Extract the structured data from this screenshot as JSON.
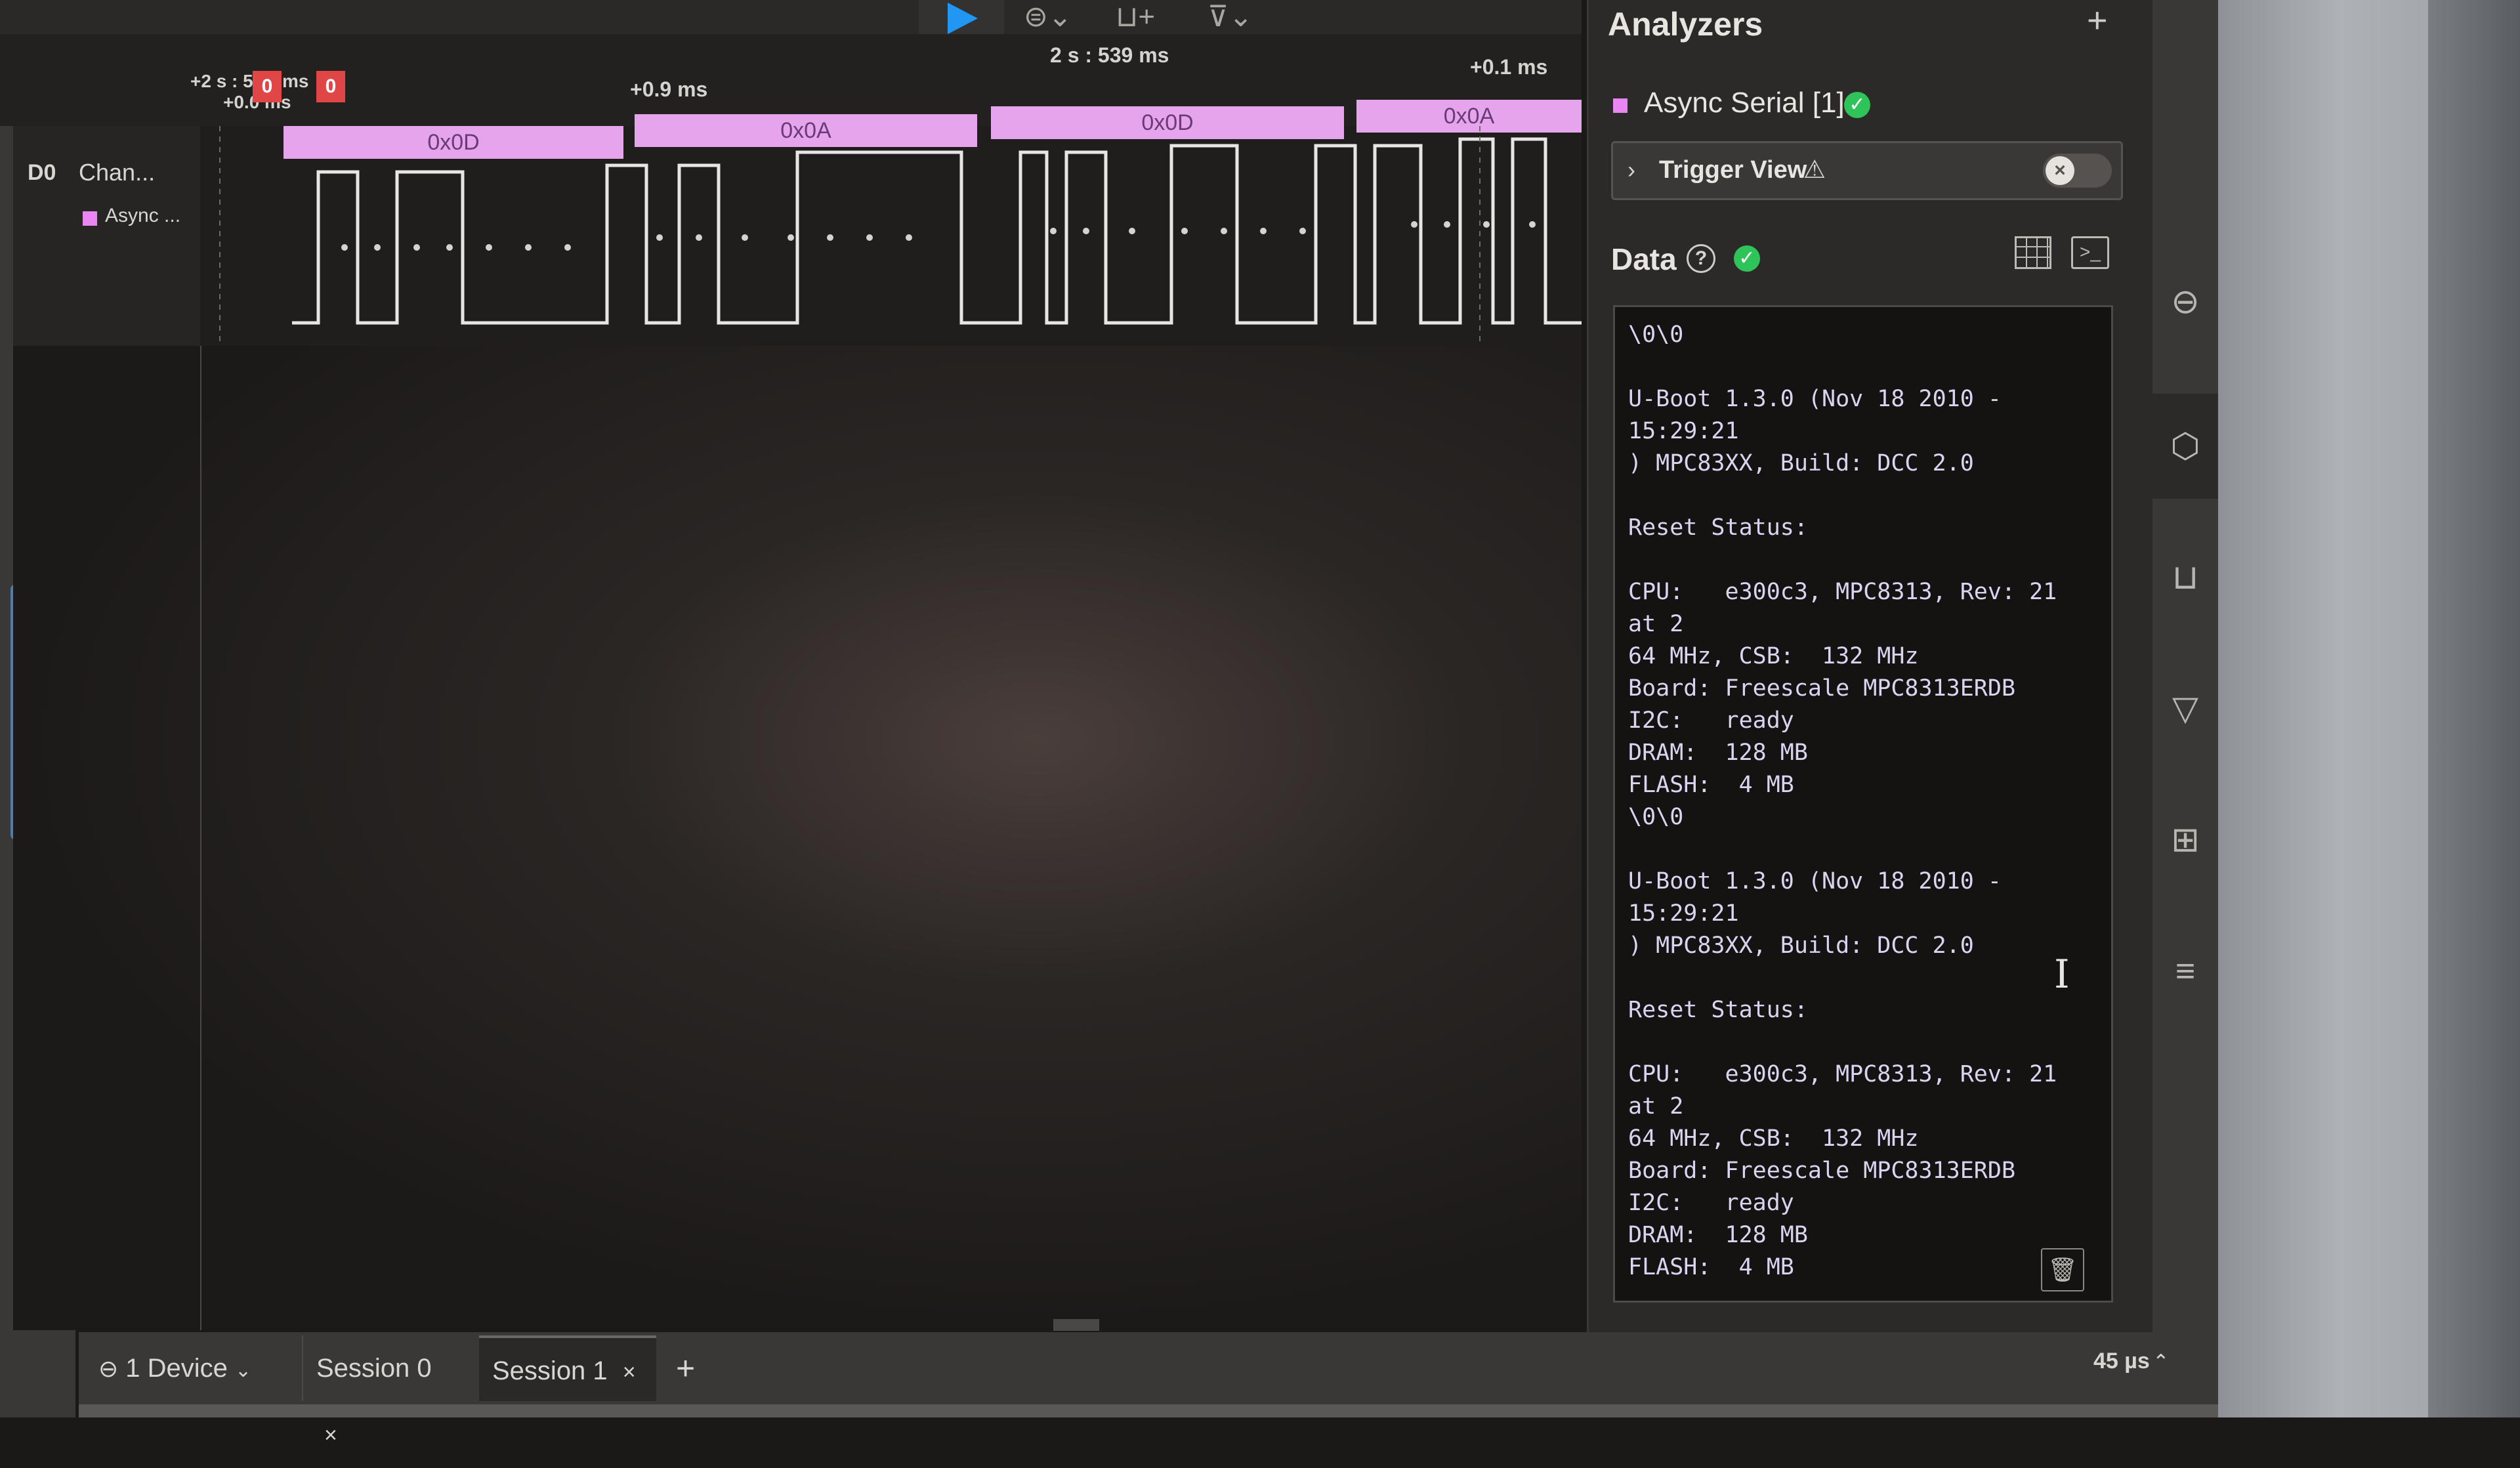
{
  "toolbar": {
    "play_icon": "play-icon",
    "tool_icons": [
      "analyzer-icon",
      "measure-icon",
      "trigger-icon"
    ]
  },
  "timeline": {
    "left_offset_top": "+2 s : 5",
    "left_offset_unit": "ms",
    "left_offset_bottom": "+0.0 ms",
    "marker_0": "0",
    "marker_1": "0",
    "label_1": "+0.9 ms",
    "center_time": "2 s : 539 ms",
    "label_right": "+0.1 ms"
  },
  "channel": {
    "id": "D0",
    "name": "Chan...",
    "analyzer": "Async ..."
  },
  "decodes": [
    "0x0D",
    "0x0A",
    "0x0D",
    "0x0A"
  ],
  "panel": {
    "title": "Analyzers",
    "add_icon": "plus-icon",
    "analyzer_name": "Async Serial [1]",
    "status": "check-icon",
    "trigger_label": "Trigger View",
    "trigger_warning": "warning-icon",
    "data_title": "Data",
    "help_icon": "help-icon",
    "terminal": "\\0\\0\n\nU-Boot 1.3.0 (Nov 18 2010 - 15:29:21\n) MPC83XX, Build: DCC 2.0\n\nReset Status:\n\nCPU:   e300c3, MPC8313, Rev: 21 at 2\n64 MHz, CSB:  132 MHz\nBoard: Freescale MPC8313ERDB\nI2C:   ready\nDRAM:  128 MB\nFLASH:  4 MB\n\\0\\0\n\nU-Boot 1.3.0 (Nov 18 2010 - 15:29:21\n) MPC83XX, Build: DCC 2.0\n\nReset Status:\n\nCPU:   e300c3, MPC8313, Rev: 21 at 2\n64 MHz, CSB:  132 MHz\nBoard: Freescale MPC8313ERDB\nI2C:   ready\nDRAM:  128 MB\nFLASH:  4 MB"
  },
  "bottom": {
    "device": "1 Device",
    "session_0": "Session 0",
    "session_1": "Session 1",
    "close": "×",
    "add": "+",
    "status_time": "45 µs"
  },
  "colors": {
    "accent": "#2196f3",
    "decode": "#e6a4ec",
    "marker": "#e04646",
    "ok": "#2ec45a"
  }
}
